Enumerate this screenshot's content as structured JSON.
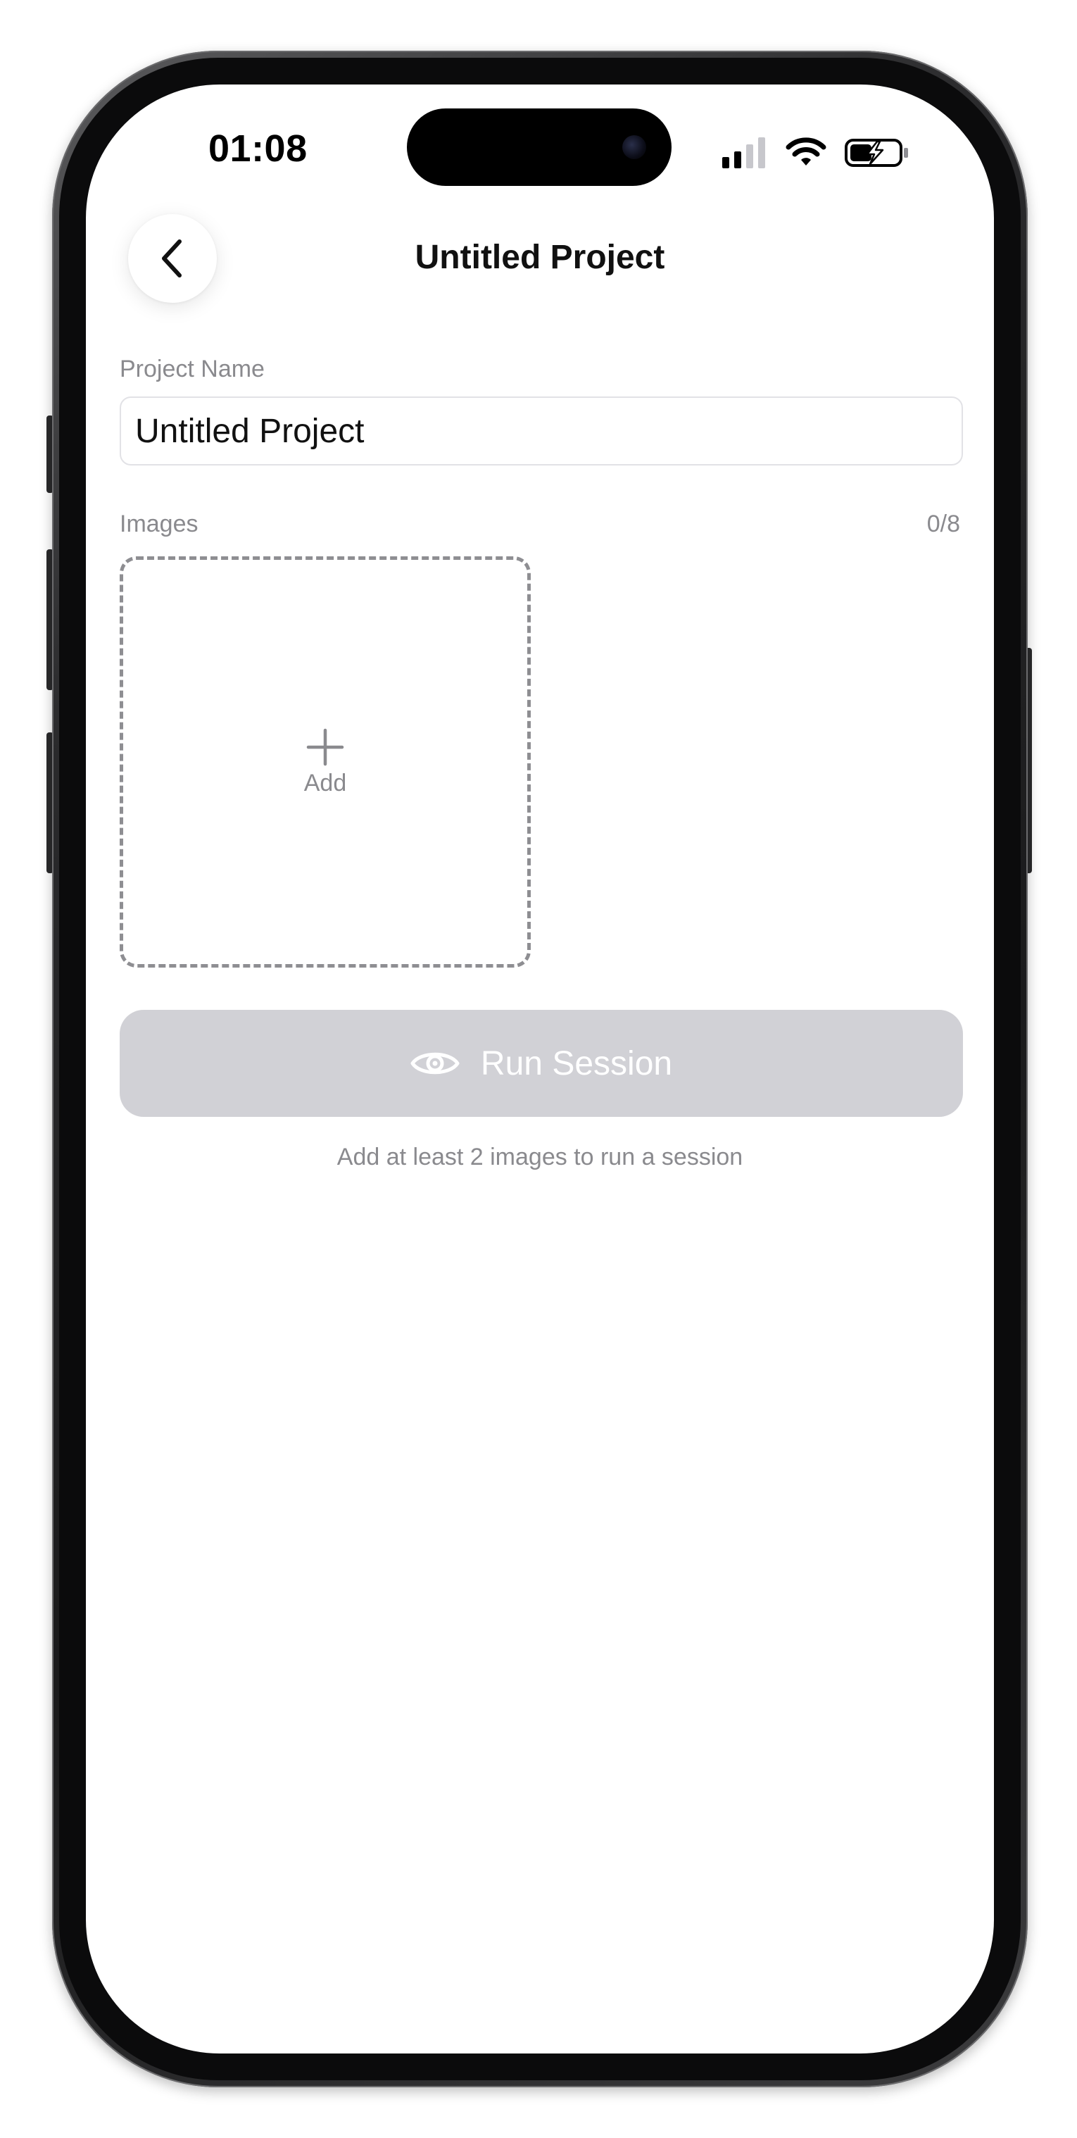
{
  "status_bar": {
    "time": "01:08",
    "signal_icon": "cellular-signal-icon",
    "wifi_icon": "wifi-icon",
    "battery_icon": "battery-charging-icon"
  },
  "header": {
    "back_icon": "chevron-left-icon",
    "title": "Untitled Project"
  },
  "form": {
    "project_name_label": "Project Name",
    "project_name_value": "Untitled Project",
    "images_label": "Images",
    "images_count": "0/8",
    "add_tile": {
      "icon": "plus-icon",
      "label": "Add"
    }
  },
  "run_button": {
    "icon": "eye-icon",
    "label": "Run Session",
    "enabled": false
  },
  "hint": "Add at least 2 images to run a session",
  "colors": {
    "disabled_button": "#d1d1d6",
    "secondary_text": "#8a8a8e",
    "primary_text": "#111111",
    "input_border": "#e2e2e6"
  }
}
